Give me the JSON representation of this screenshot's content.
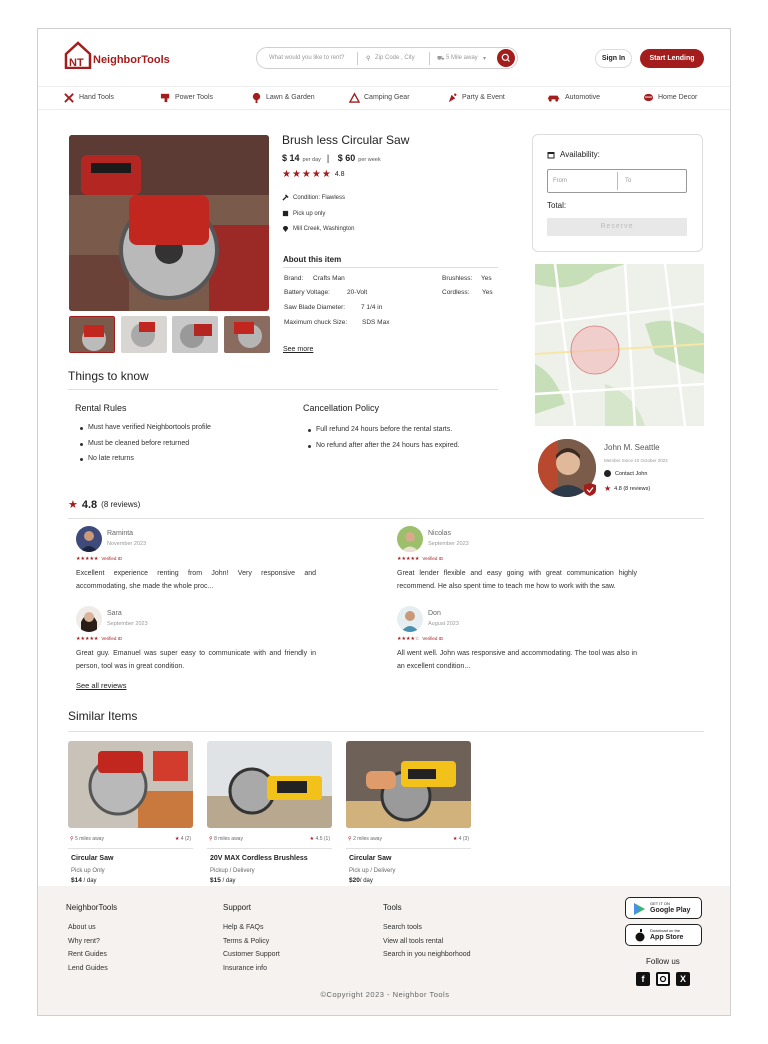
{
  "brand": {
    "name": "NeighborTools",
    "logo_letters": "NT",
    "accent": "#a31d1d"
  },
  "search": {
    "query_placeholder": "What would you like to rent?",
    "location_placeholder": "Zip Code , City",
    "distance": "5 Mile away"
  },
  "header": {
    "signin": "Sign In",
    "start_lending": "Start Lending"
  },
  "nav": [
    {
      "label": "Hand Tools",
      "icon": "hand-tools-icon"
    },
    {
      "label": "Power Tools",
      "icon": "power-tools-icon"
    },
    {
      "label": "Lawn & Garden",
      "icon": "lawn-garden-icon"
    },
    {
      "label": "Camping Gear",
      "icon": "camping-gear-icon"
    },
    {
      "label": "Party & Event",
      "icon": "party-event-icon"
    },
    {
      "label": "Automotive",
      "icon": "automotive-icon"
    },
    {
      "label": "Home Decor",
      "icon": "home-decor-icon"
    }
  ],
  "product": {
    "title": "Brush less Circular Saw",
    "price_day": "$ 14",
    "per_day": "per day",
    "price_week": "$ 60",
    "per_week": "per week",
    "rating": "4.8",
    "condition": "Condition: Flawless",
    "pickup": "Pick up only",
    "location": "Mill Creek, Washington",
    "about_title": "About this item",
    "specs": {
      "brand_label": "Brand:",
      "brand_value": "Crafts Man",
      "voltage_label": "Battery Voltage:",
      "voltage_value": "20-Volt",
      "blade_label": "Saw Blade Diameter:",
      "blade_value": "7 1/4 in",
      "chuck_label": "Maximum chuck Size:",
      "chuck_value": "SDS Max",
      "brushless_label": "Brushless:",
      "brushless_value": "Yes",
      "cordless_label": "Cordless:",
      "cordless_value": "Yes"
    },
    "see_more": "See more"
  },
  "availability": {
    "title": "Availability:",
    "from": "From",
    "to": "To",
    "total": "Total:",
    "reserve": "Reserve"
  },
  "owner": {
    "name": "John M. Seattle",
    "since": "Member Since 10 October 2022",
    "contact": "Contact John",
    "rating": "4.8 (8 reviews)"
  },
  "things": {
    "title": "Things to know",
    "rental_title": "Rental Rules",
    "rental_rules": [
      "Must have verified Neighbortools profile",
      "Must be cleaned before returned",
      "No late returns"
    ],
    "cancel_title": "Cancellation Policy",
    "cancel_rules": [
      "Full refund 24 hours before the rental starts.",
      "No refund after after the 24 hours has expired."
    ]
  },
  "reviews": {
    "rating": "4.8",
    "count": "(8 reviews)",
    "items": [
      {
        "name": "Raminta",
        "date": "November 2023",
        "stars": "★★★★★",
        "verified": "Verified ID",
        "text": "Excellent experience renting from John! Very responsive and accommodating, she made the whole proc..."
      },
      {
        "name": "Nicolas",
        "date": "September 2023",
        "stars": "★★★★★",
        "verified": "Verified ID",
        "text": "Great lender flexible and easy going with great communication highly recommend. He also spent time to teach me how to work with the saw."
      },
      {
        "name": "Sara",
        "date": "September 2023",
        "stars": "★★★★★",
        "verified": "Verified ID",
        "text": "Great guy. Emanuel was super easy to communicate with and friendly in person, tool was in great condition."
      },
      {
        "name": "Don",
        "date": "August 2023",
        "stars": "★★★★☆",
        "verified": "Verified ID",
        "text": "All went well. John was responsive and accommodating. The tool was also in an excellent condition..."
      }
    ],
    "see_all": "See all reviews"
  },
  "similar": {
    "title": "Similar Items",
    "items": [
      {
        "distance": "5 miles away",
        "rating": "4",
        "count": "(2)",
        "name": "Circular Saw",
        "option": "Pick up Only",
        "price": "$14",
        "unit": " / day"
      },
      {
        "distance": "8 miles away",
        "rating": "4.5",
        "count": "(1)",
        "name": "20V MAX Cordless Brushless",
        "option": "Pickup / Delivery",
        "price": "$15",
        "unit": " / day"
      },
      {
        "distance": "2 miles away",
        "rating": "4",
        "count": "(3)",
        "name": "Circular Saw",
        "option": "Pick up / Delivery",
        "price": "$20",
        "unit": "/ day"
      }
    ]
  },
  "footer": {
    "col1_title": "NeighborTools",
    "col1": [
      "About us",
      "Why rent?",
      "Rent  Guides",
      "Lend  Guides"
    ],
    "col2_title": "Support",
    "col2": [
      "Help & FAQs",
      "Terms & Policy",
      "Customer Support",
      "Insurance info"
    ],
    "col3_title": "Tools",
    "col3": [
      "Search tools",
      "View all tools rental",
      "Search in you neighborhood"
    ],
    "google_top": "GET IT ON",
    "google_bottom": "Google Play",
    "apple_top": "Download on the",
    "apple_bottom": "App Store",
    "follow": "Follow us",
    "copyright": "©Copyright 2023 - Neighbor Tools"
  }
}
